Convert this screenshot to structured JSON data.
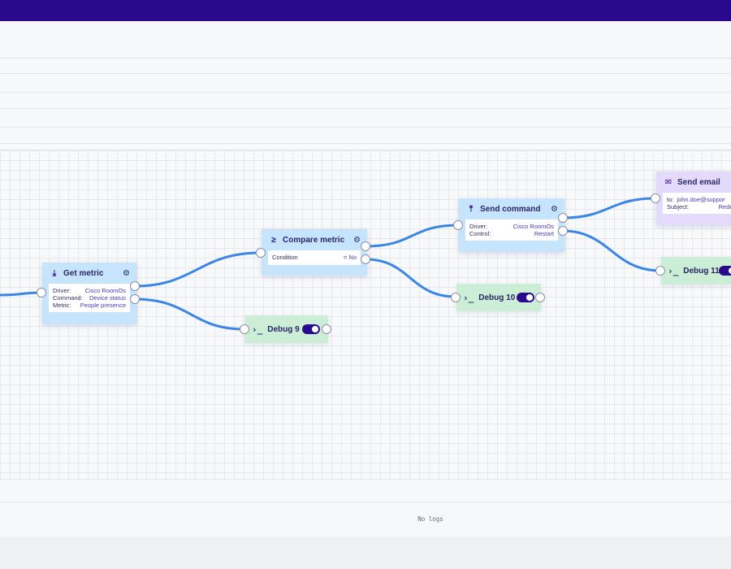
{
  "nodes": {
    "get_metric": {
      "title": "Get metric",
      "fields": [
        {
          "key": "Driver:",
          "value": "Cisco RoomOs"
        },
        {
          "key": "Command:",
          "value": "Device status"
        },
        {
          "key": "Metric:",
          "value": "People presence"
        }
      ]
    },
    "compare_metric": {
      "title": "Compare metric",
      "fields": [
        {
          "key": "Condition",
          "value": "= No"
        }
      ]
    },
    "send_command": {
      "title": "Send command",
      "fields": [
        {
          "key": "Driver:",
          "value": "Cisco RoomOs"
        },
        {
          "key": "Control:",
          "value": "Restart"
        }
      ]
    },
    "send_email": {
      "title": "Send email",
      "fields": [
        {
          "key": "to:",
          "value": "john.doe@suppor"
        },
        {
          "key": "Subject:",
          "value": "Redema"
        }
      ]
    }
  },
  "debug": {
    "debug9": {
      "label": "Debug 9",
      "enabled": true
    },
    "debug10": {
      "label": "Debug 10",
      "enabled": true
    },
    "debug11": {
      "label": "Debug 11",
      "enabled": true
    }
  },
  "logs": {
    "empty_text": "No logs"
  },
  "colors": {
    "topbar": "#2a0a8c",
    "node": "#c7e4fd",
    "debug_node": "#cdeed6",
    "email_node": "#e3dafc",
    "wire": "#3a86e6"
  }
}
